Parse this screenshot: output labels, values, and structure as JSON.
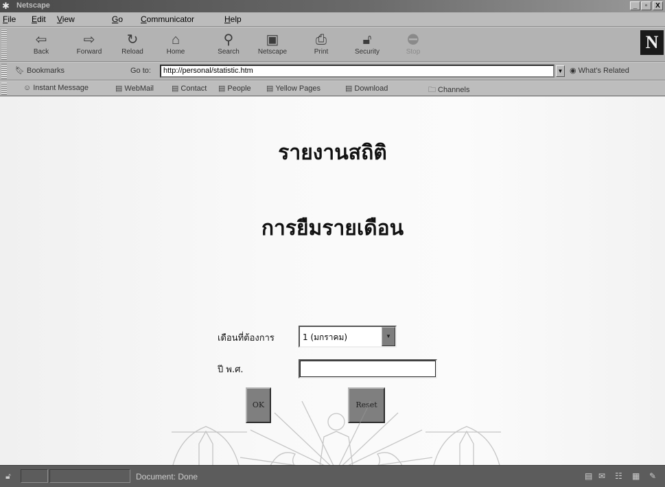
{
  "window": {
    "title": "Netscape",
    "controls": {
      "minimize": "_",
      "maximize": "▫",
      "close": "X"
    }
  },
  "menu": {
    "items": [
      {
        "u": "F",
        "rest": "ile"
      },
      {
        "u": "E",
        "rest": "dit"
      },
      {
        "u": "V",
        "rest": "iew"
      },
      {
        "u": "G",
        "rest": "o"
      },
      {
        "u": "C",
        "rest": "ommunicator"
      },
      {
        "u": "H",
        "rest": "elp"
      }
    ]
  },
  "toolbar": {
    "back": "Back",
    "forward": "Forward",
    "reload": "Reload",
    "home": "Home",
    "search": "Search",
    "netscape": "Netscape",
    "print": "Print",
    "security": "Security",
    "stop": "Stop",
    "logo": "N"
  },
  "location": {
    "bookmarks": "Bookmarks",
    "goto_label": "Go to:",
    "url": "http://personal/statistic.htm",
    "whats_related": "What's Related"
  },
  "personal_toolbar": {
    "instant_message": "Instant Message",
    "webmail": "WebMail",
    "contact": "Contact",
    "people": "People",
    "yellow_pages": "Yellow Pages",
    "download": "Download",
    "channels": "Channels"
  },
  "page": {
    "heading1": "รายงานสถิติ",
    "heading2": "การยืมรายเดือน",
    "month_label": "เดือนที่ต้องการ",
    "month_value": "1 (มกราคม)",
    "year_label": "ปี พ.ศ.",
    "year_value": "",
    "ok_button": "OK",
    "reset_button": "Reset"
  },
  "status": {
    "text": "Document: Done"
  }
}
